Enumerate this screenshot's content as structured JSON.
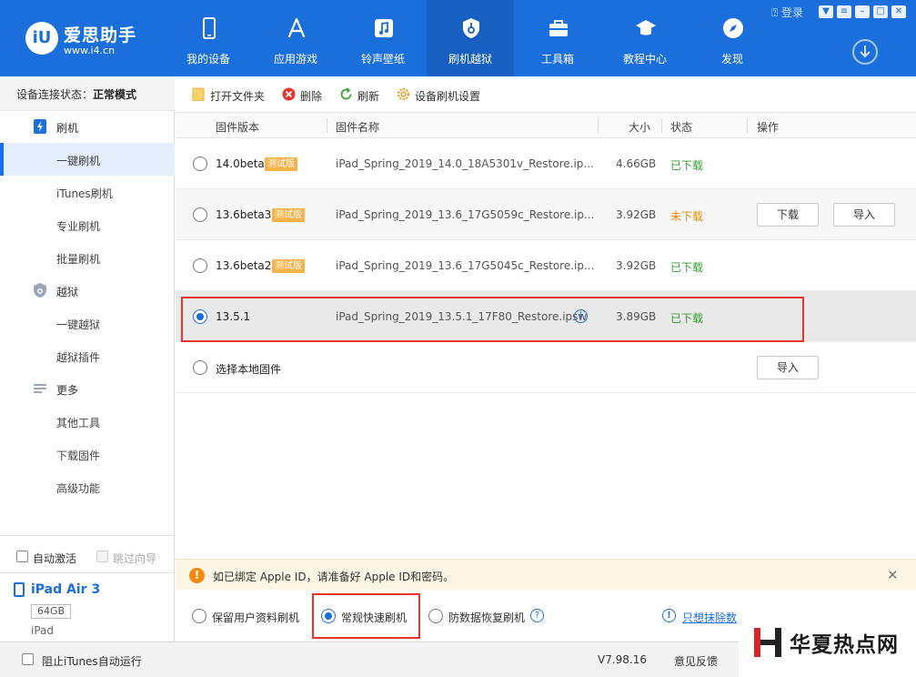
{
  "header": {
    "brand": "爱思助手",
    "url": "www.i4.cn",
    "login": "登录",
    "tabs": [
      {
        "label": "我的设备",
        "icon": "phone-icon"
      },
      {
        "label": "应用游戏",
        "icon": "app-store-icon"
      },
      {
        "label": "铃声壁纸",
        "icon": "music-icon"
      },
      {
        "label": "刷机越狱",
        "icon": "shield-icon",
        "active": true
      },
      {
        "label": "工具箱",
        "icon": "toolbox-icon"
      },
      {
        "label": "教程中心",
        "icon": "graduation-cap-icon"
      },
      {
        "label": "发现",
        "icon": "compass-icon"
      }
    ]
  },
  "sidebar": {
    "status_label": "设备连接状态：",
    "status_value": "正常模式",
    "groups": [
      {
        "label": "刷机",
        "icon": "flash-icon",
        "items": [
          "一键刷机",
          "iTunes刷机",
          "专业刷机",
          "批量刷机"
        ]
      },
      {
        "label": "越狱",
        "icon": "jailbreak-shield-icon",
        "items": [
          "一键越狱",
          "越狱插件"
        ]
      },
      {
        "label": "更多",
        "icon": "menu-lines-icon",
        "items": [
          "其他工具",
          "下载固件",
          "高级功能"
        ]
      }
    ],
    "auto_activate": "自动激活",
    "skip_guide": "跳过向导",
    "device": {
      "name": "iPad Air 3",
      "capacity": "64GB",
      "type": "iPad"
    }
  },
  "toolbar": {
    "open_folder": "打开文件夹",
    "delete": "删除",
    "refresh": "刷新",
    "settings": "设备刷机设置"
  },
  "table": {
    "headers": {
      "version": "固件版本",
      "name": "固件名称",
      "size": "大小",
      "status": "状态",
      "action": "操作"
    },
    "rows": [
      {
        "version": "14.0beta",
        "beta": "测试版",
        "name": "iPad_Spring_2019_14.0_18A5301v_Restore.ip...",
        "size": "4.66GB",
        "status": "已下载"
      },
      {
        "version": "13.6beta3",
        "beta": "测试版",
        "name": "iPad_Spring_2019_13.6_17G5059c_Restore.ip...",
        "size": "3.92GB",
        "status": "未下载",
        "btn1": "下载",
        "btn2": "导入"
      },
      {
        "version": "13.6beta2",
        "beta": "测试版",
        "name": "iPad_Spring_2019_13.6_17G5045c_Restore.ip...",
        "size": "3.92GB",
        "status": "已下载"
      },
      {
        "version": "13.5.1",
        "name": "iPad_Spring_2019_13.5.1_17F80_Restore.ipsw",
        "size": "3.89GB",
        "status": "已下载"
      }
    ],
    "local_label": "选择本地固件",
    "local_import": "导入"
  },
  "notice": {
    "text": "如已绑定 Apple ID，请准备好 Apple ID和密码。"
  },
  "modes": {
    "keep_data": "保留用户资料刷机",
    "quick": "常规快速刷机",
    "anti_recovery": "防数据恢复刷机",
    "erase_link": "只想抹除数"
  },
  "statusbar": {
    "itunes": "阻止iTunes自动运行",
    "version": "V7.98.16",
    "feedback": "意见反馈"
  },
  "watermark": {
    "text": "华夏热点网"
  },
  "colors": {
    "brand_blue": "#1b6fdc",
    "downloaded": "#2f9e2f",
    "not_downloaded": "#e08a00",
    "highlight": "#e8342c"
  }
}
